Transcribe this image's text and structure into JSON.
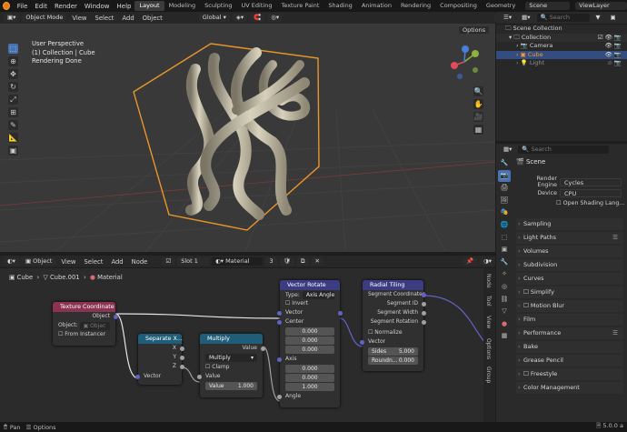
{
  "menu": [
    "File",
    "Edit",
    "Render",
    "Window",
    "Help"
  ],
  "workspaces": [
    "Layout",
    "Modeling",
    "Sculpting",
    "UV Editing",
    "Texture Paint",
    "Shading",
    "Animation",
    "Rendering",
    "Compositing",
    "Geometry"
  ],
  "scene_name": "Scene",
  "view_layer": "ViewLayer",
  "viewport": {
    "mode": "Object Mode",
    "menus": [
      "View",
      "Select",
      "Add",
      "Object"
    ],
    "orientation": "Global",
    "options": "Options",
    "overlay": [
      "User Perspective",
      "(1) Collection | Cube",
      "Rendering Done"
    ]
  },
  "outliner": {
    "search_placeholder": "Search",
    "items": [
      "Scene Collection",
      "Collection",
      "Camera",
      "Cube",
      "Light"
    ]
  },
  "properties": {
    "search_placeholder": "Search",
    "title": "Scene",
    "render_engine_label": "Render Engine",
    "render_engine": "Cycles",
    "device_label": "Device",
    "device": "CPU",
    "osl_label": "Open Shading Lang...",
    "panels": [
      "Sampling",
      "Light Paths",
      "Volumes",
      "Subdivision",
      "Curves",
      "Simplify",
      "Motion Blur",
      "Film",
      "Performance",
      "Bake",
      "Grease Pencil",
      "Freestyle",
      "Color Management"
    ]
  },
  "node_editor": {
    "type": "Object",
    "menus": [
      "View",
      "Select",
      "Add",
      "Node"
    ],
    "slot": "Slot 1",
    "material": "Material",
    "users": "3",
    "breadcrumb": [
      "Cube",
      "Cube.001",
      "Material"
    ],
    "side_tabs": [
      "Node",
      "Tool",
      "View",
      "Options",
      "Group"
    ]
  },
  "nodes": {
    "texcoord": {
      "title": "Texture Coordinate",
      "out_object": "Object",
      "object_label": "Object:",
      "object_placeholder": "Objec",
      "from_instancer": "From Instancer"
    },
    "separate": {
      "title": "Separate X...",
      "x": "X",
      "y": "Y",
      "z": "Z",
      "in_vector": "Vector"
    },
    "multiply": {
      "title": "Multiply",
      "out_value": "Value",
      "op": "Multiply",
      "clamp": "Clamp",
      "in_value": "Value",
      "value_label": "Value",
      "value": "1.000"
    },
    "vrotate": {
      "title": "Vector Rotate",
      "type_label": "Type:",
      "type": "Axis Angle",
      "invert": "Invert",
      "vector": "Vector",
      "center": "Center",
      "c1": "0.000",
      "c2": "0.000",
      "c3": "0.000",
      "axis": "Axis",
      "a1": "0.000",
      "a2": "0.000",
      "a3": "1.000",
      "angle": "Angle"
    },
    "radial": {
      "title": "Radial Tiling",
      "out1": "Segment Coordinates",
      "out2": "Segment ID",
      "out3": "Segment Width",
      "out4": "Segment Rotation",
      "normalize": "Normalize",
      "vector": "Vector",
      "sides_label": "Sides",
      "sides": "5.000",
      "round_label": "Roundn...",
      "round": "0.000"
    }
  },
  "status": {
    "left": "Pan",
    "options": "Options",
    "version": "5.0.0 a"
  },
  "colors": {
    "accent": "#4772b3",
    "selection": "#e8952b",
    "vector_socket": "#6363c7"
  }
}
